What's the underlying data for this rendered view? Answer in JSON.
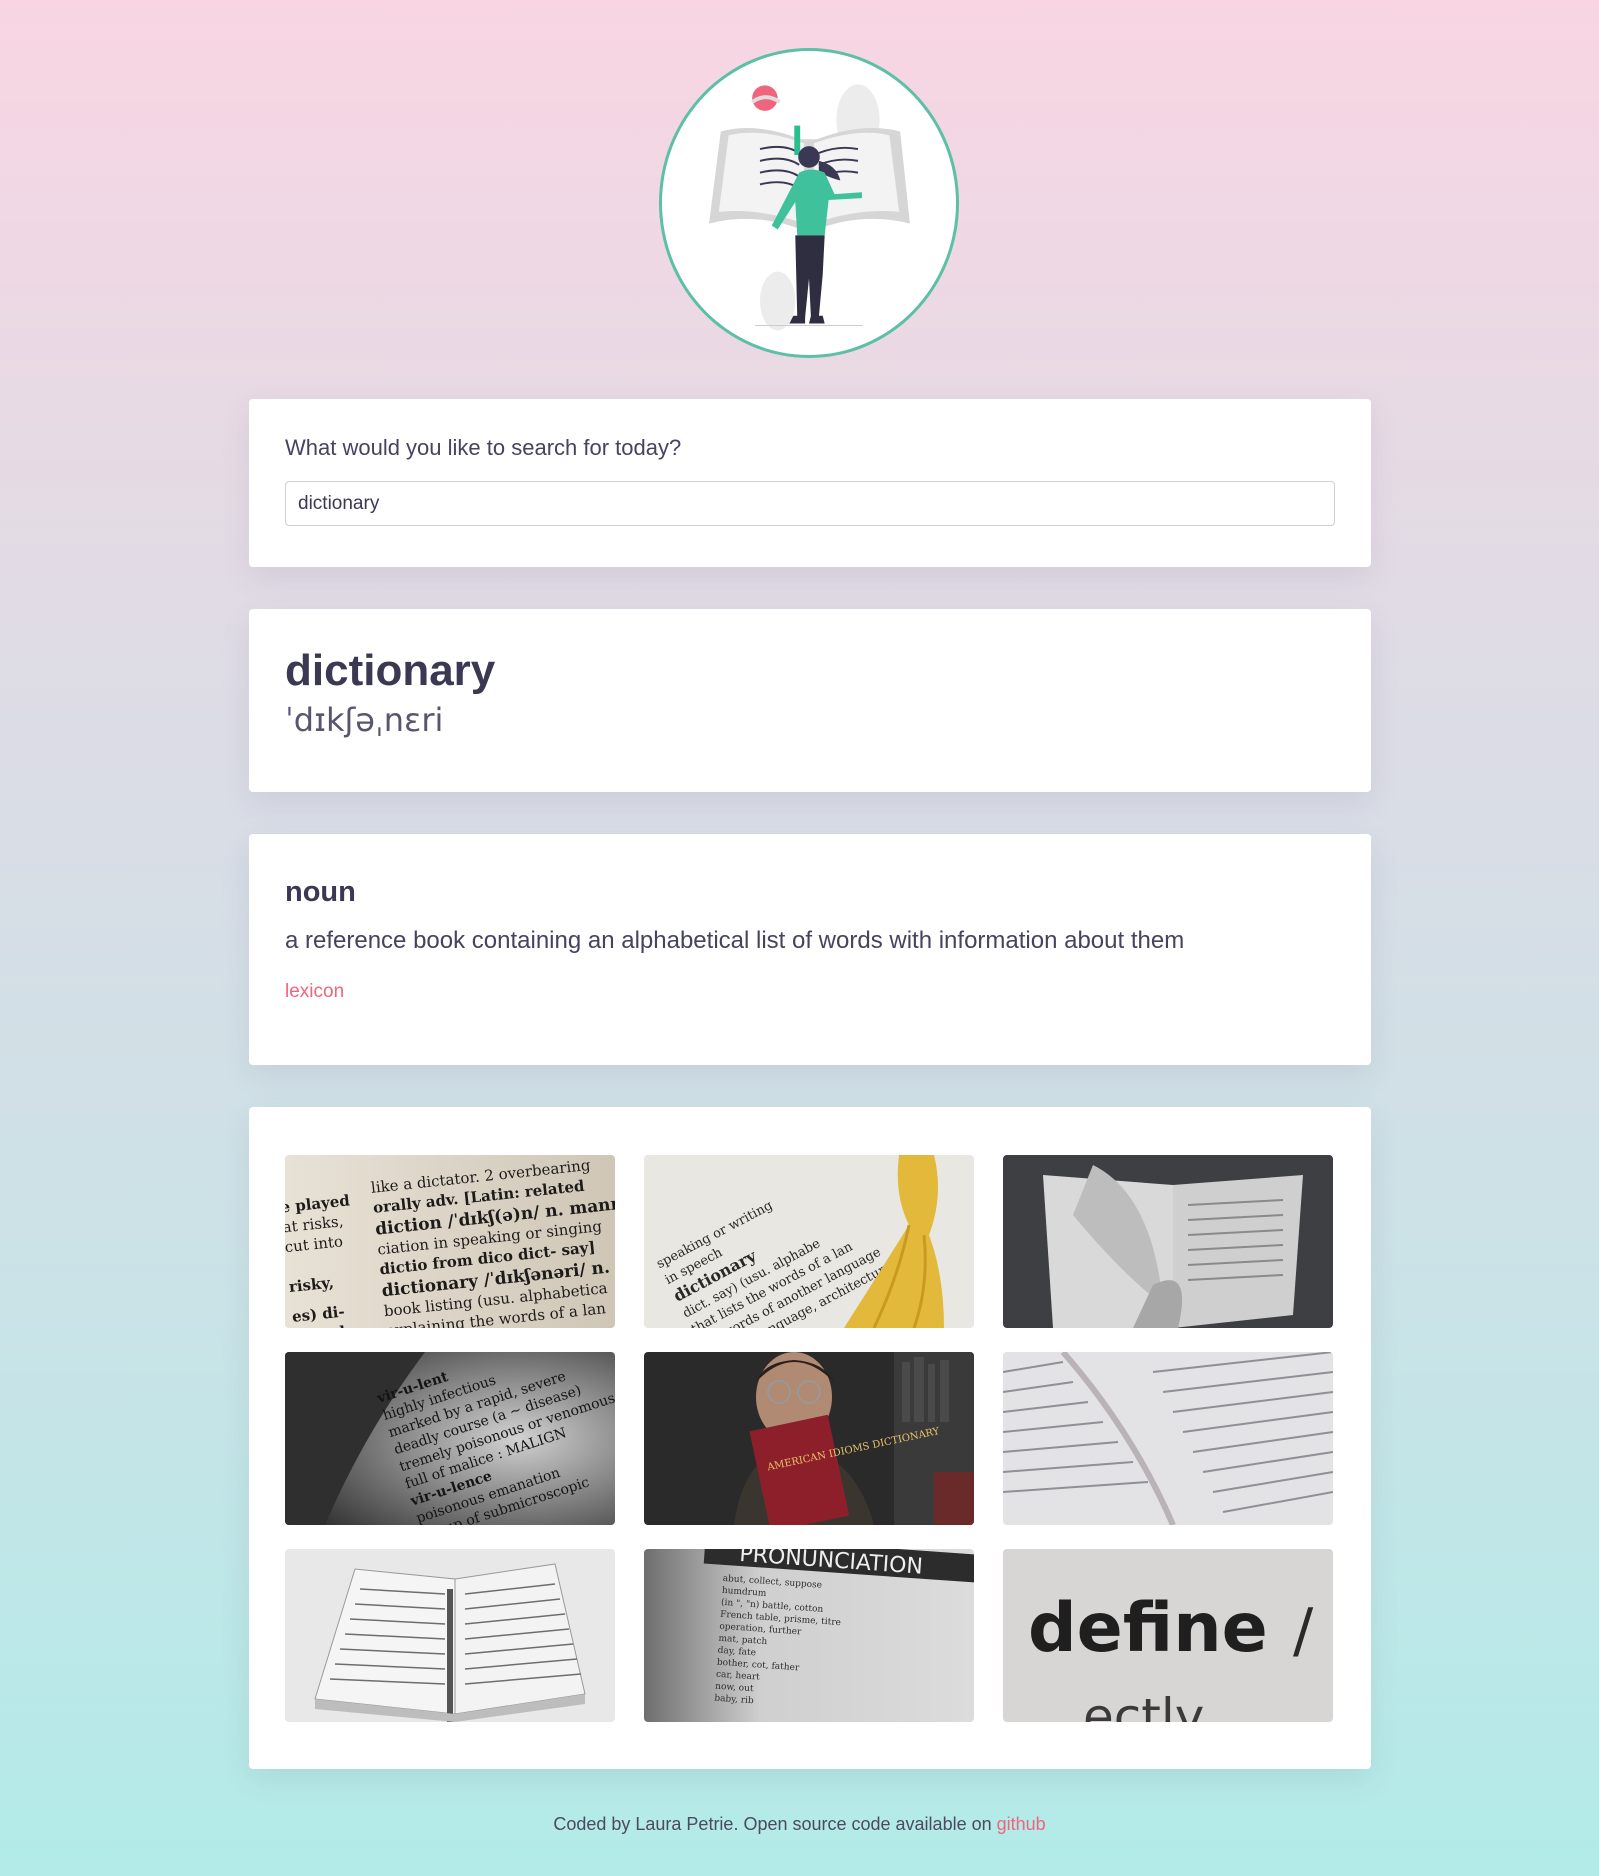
{
  "search": {
    "label": "What would you like to search for today?",
    "value": "dictionary"
  },
  "result": {
    "word": "dictionary",
    "phonetic": "ˈdɪkʃəˌnɛri"
  },
  "meaning": {
    "part_of_speech": "noun",
    "definition": "a reference book containing an alphabetical list of words with information about them",
    "synonym": "lexicon"
  },
  "photos": [
    {
      "alt": "dictionary entry close-up",
      "text": "dictionary /ˈdɪkʃənəri/ n."
    },
    {
      "alt": "dictionary page with yellow tassel",
      "text": "dictionary"
    },
    {
      "alt": "open book black and white",
      "text": ""
    },
    {
      "alt": "dictionary page virulent",
      "text": "vir-u-lent"
    },
    {
      "alt": "man holding American Idioms Dictionary",
      "text": "AMERICAN IDIOMS DICTIONARY"
    },
    {
      "alt": "open dictionary pages",
      "text": ""
    },
    {
      "alt": "open book with pen",
      "text": ""
    },
    {
      "alt": "pronunciation page",
      "text": "PRONUNCIATION"
    },
    {
      "alt": "define close-up",
      "text": "define"
    }
  ],
  "footer": {
    "text": "Coded by Laura Petrie. Open source code available on ",
    "link": "github"
  },
  "colors": {
    "accent": "#f0657e",
    "logo_ring": "#5cbfa6",
    "text": "#3a3852"
  }
}
